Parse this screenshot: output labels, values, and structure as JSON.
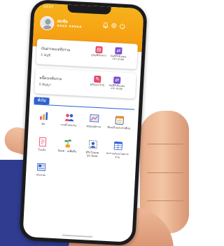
{
  "status_bar": {
    "time": "10:07"
  },
  "user": {
    "name": "สมชัย",
    "id": "xxxx xxxxx"
  },
  "header_icons": [
    "bell-icon",
    "settings-icon",
    "power-icon"
  ],
  "savings_card": {
    "title": "เงินฝากคงเหลือรวม",
    "count": "3 บัญชี",
    "actions": [
      {
        "label": "ดูบัญชีเงินฝาก",
        "icon": "bank-book-icon",
        "color": "#e84a6a"
      },
      {
        "label": "บัญชีที่เชื่อมต่อแล้ว สนสุด",
        "icon": "linked-account-icon",
        "color": "#7a4fd0"
      }
    ]
  },
  "loan_card": {
    "title": "หนี้คงเหลือรวม",
    "count": "0 สัญญา",
    "actions": [
      {
        "label": "ดูสัญญาเงินกู้",
        "icon": "contract-icon",
        "color": "#e84a6a"
      },
      {
        "label": "บัญชีที่เชื่อมต่อแล้ว สนสุด",
        "icon": "linked-account-icon",
        "color": "#7a4fd0"
      }
    ]
  },
  "section": {
    "title": "ทั่วไป"
  },
  "menu": [
    {
      "label": "หุ้น",
      "icon": "stock-chart-icon",
      "glyph": "📊"
    },
    {
      "label": "การค้ำประกัน",
      "icon": "guarantee-people-icon",
      "glyph": "👥"
    },
    {
      "label": "สรุปยอดรวม",
      "icon": "summary-chart-icon",
      "glyph": "📈"
    },
    {
      "label": "เรียกเก็บประจำเดือน",
      "icon": "monthly-bill-icon",
      "glyph": "📅"
    },
    {
      "label": "ใบแจ้ง",
      "icon": "notice-document-icon",
      "glyph": "📄"
    },
    {
      "label": "ปันผล - เฉลี่ยคืน",
      "icon": "dividend-plant-icon",
      "glyph": "🌱"
    },
    {
      "label": "ผู้รับโอนผลประโยชน์",
      "icon": "beneficiary-icon",
      "glyph": "🧑"
    },
    {
      "label": "ตารางประมาณการจ่าย",
      "icon": "payment-table-icon",
      "glyph": "📋"
    },
    {
      "label": "ประกาศ",
      "icon": "announcement-icon",
      "glyph": "📰"
    }
  ]
}
